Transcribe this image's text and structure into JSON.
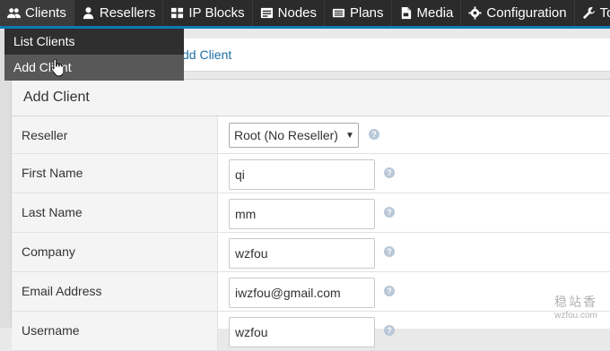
{
  "nav": {
    "items": [
      {
        "label": "Clients",
        "icon": "users-icon"
      },
      {
        "label": "Resellers",
        "icon": "user-icon"
      },
      {
        "label": "IP Blocks",
        "icon": "grid-icon"
      },
      {
        "label": "Nodes",
        "icon": "server-icon"
      },
      {
        "label": "Plans",
        "icon": "list-icon"
      },
      {
        "label": "Media",
        "icon": "file-icon"
      },
      {
        "label": "Configuration",
        "icon": "gear-icon"
      },
      {
        "label": "Tools",
        "icon": "wrench-icon"
      }
    ]
  },
  "dropdown": {
    "items": [
      {
        "label": "List Clients"
      },
      {
        "label": "Add Client"
      }
    ]
  },
  "breadcrumb": {
    "link": "dd Client"
  },
  "panel": {
    "title": "Add Client",
    "fields": {
      "reseller": {
        "label": "Reseller",
        "value": "Root (No Reseller)"
      },
      "first_name": {
        "label": "First Name",
        "value": "qi"
      },
      "last_name": {
        "label": "Last Name",
        "value": "mm"
      },
      "company": {
        "label": "Company",
        "value": "wzfou"
      },
      "email": {
        "label": "Email Address",
        "value": "iwzfou@gmail.com"
      },
      "username": {
        "label": "Username",
        "value": "wzfou"
      }
    },
    "help_glyph": "?"
  },
  "watermark": {
    "line1": "稳站香",
    "line2": "wzfou.com"
  },
  "colors": {
    "nav_bg": "#2b2b2b",
    "nav_accent": "#0f79b7",
    "link": "#1d6fa5",
    "panel_header_bg": "#f4f4f4"
  }
}
